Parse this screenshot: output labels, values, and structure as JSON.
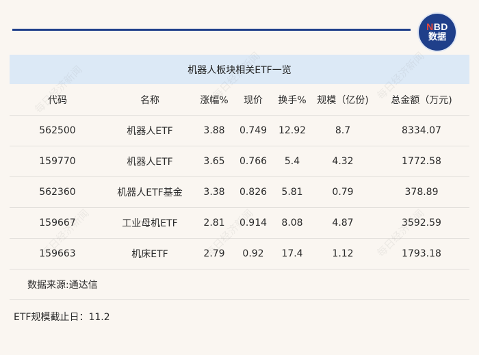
{
  "logo": {
    "line1_n": "N",
    "line1_rest": "BD",
    "line2": "数据"
  },
  "title": "机器人板块相关ETF一览",
  "columns": [
    "代码",
    "名称",
    "涨幅%",
    "现价",
    "换手%",
    "规模（亿份)",
    "总金额（万元)"
  ],
  "rows": [
    [
      "562500",
      "机器人ETF",
      "3.88",
      "0.749",
      "12.92",
      "8.7",
      "8334.07"
    ],
    [
      "159770",
      "机器人ETF",
      "3.65",
      "0.766",
      "5.4",
      "4.32",
      "1772.58"
    ],
    [
      "562360",
      "机器人ETF基金",
      "3.38",
      "0.826",
      "5.81",
      "0.79",
      "378.89"
    ],
    [
      "159667",
      "工业母机ETF",
      "2.81",
      "0.914",
      "8.08",
      "4.87",
      "3592.59"
    ],
    [
      "159663",
      "机床ETF",
      "2.79",
      "0.92",
      "17.4",
      "1.12",
      "1793.18"
    ]
  ],
  "source": "数据来源:通达信",
  "note": "ETF规模截止日：11.2",
  "watermark": "每日经济新闻",
  "colors": {
    "brand": "#1f3f8a",
    "header_bg": "#dce9f6",
    "background": "#faf6f1",
    "logo_accent": "#e8463a"
  }
}
